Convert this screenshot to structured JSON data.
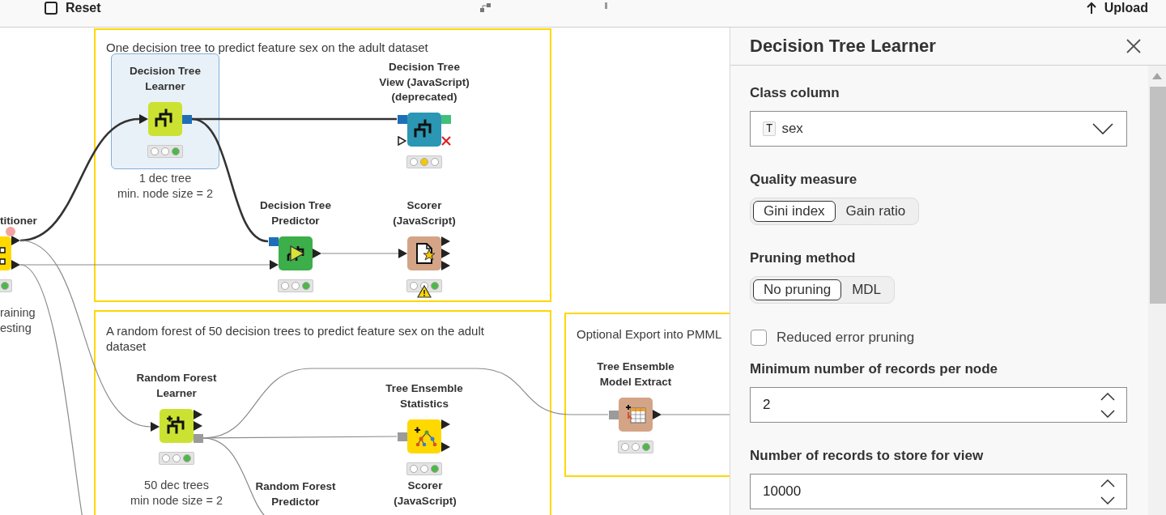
{
  "toolbar": {
    "items": [
      {
        "label": "Reset"
      },
      {
        "label": "Upload"
      }
    ]
  },
  "workflow": {
    "annotations": [
      {
        "text": "One decision tree to predict feature sex on the adult dataset"
      },
      {
        "text": "A random forest of 50 decision trees to predict feature sex on the adult dataset"
      },
      {
        "text": "Optional Export into PMML"
      }
    ],
    "nodes": [
      {
        "title": "titioner",
        "kind": "manipulator",
        "selected": false,
        "lights": [
          {
            "color": "#4db848"
          }
        ],
        "warning": false,
        "comment": [
          "raining",
          "esting"
        ]
      },
      {
        "title": "Decision Tree Learner",
        "kind": "learner",
        "selected": true,
        "lights": [
          {
            "color": "#ffffff"
          },
          {
            "color": "#ffffff"
          },
          {
            "color": "#4db848"
          }
        ],
        "warning": false,
        "comment": [
          "1 dec tree",
          "min. node size = 2"
        ]
      },
      {
        "title": "Decision Tree View (JavaScript) (deprecated)",
        "kind": "visualizer",
        "selected": false,
        "lights": [
          {
            "color": "#ffffff"
          },
          {
            "color": "#f5c800"
          },
          {
            "color": "#ffffff"
          }
        ],
        "warning": false
      },
      {
        "title": "Decision Tree Predictor",
        "kind": "predictor",
        "selected": false,
        "lights": [
          {
            "color": "#ffffff"
          },
          {
            "color": "#ffffff"
          },
          {
            "color": "#4db848"
          }
        ],
        "warning": false
      },
      {
        "title": "Scorer (JavaScript)",
        "kind": "other",
        "selected": false,
        "lights": [
          {
            "color": "#ffffff"
          },
          {
            "color": "#ffffff"
          },
          {
            "color": "#4db848"
          }
        ],
        "warning": true
      },
      {
        "title": "Random Forest Learner",
        "kind": "learner",
        "selected": false,
        "lights": [
          {
            "color": "#ffffff"
          },
          {
            "color": "#ffffff"
          },
          {
            "color": "#4db848"
          }
        ],
        "warning": false,
        "comment": [
          "50 dec trees",
          "min node size = 2"
        ]
      },
      {
        "title": "Tree Ensemble Statistics",
        "kind": "manipulator",
        "selected": false,
        "lights": [
          {
            "color": "#ffffff"
          },
          {
            "color": "#ffffff"
          },
          {
            "color": "#4db848"
          }
        ],
        "warning": false
      },
      {
        "title": "Random Forest Predictor",
        "selected": false
      },
      {
        "title": "Scorer (JavaScript)",
        "selected": false
      },
      {
        "title": "Tree Ensemble Model Extract",
        "kind": "other",
        "selected": false,
        "lights": [
          {
            "color": "#ffffff"
          },
          {
            "color": "#ffffff"
          },
          {
            "color": "#4db848"
          }
        ],
        "warning": false
      }
    ]
  },
  "panel": {
    "title": "Decision Tree Learner",
    "settings": [
      {
        "kind": "dropdown",
        "label": "Class column",
        "type_icon": "T",
        "value": "sex"
      },
      {
        "kind": "segmented",
        "label": "Quality measure",
        "options": [
          {
            "label": "Gini index",
            "selected": true
          },
          {
            "label": "Gain ratio",
            "selected": false
          }
        ]
      },
      {
        "kind": "segmented",
        "label": "Pruning method",
        "options": [
          {
            "label": "No pruning",
            "selected": true
          },
          {
            "label": "MDL",
            "selected": false
          }
        ]
      },
      {
        "kind": "checkbox",
        "label": "Reduced error pruning",
        "checked": false
      },
      {
        "kind": "number",
        "label": "Minimum number of records per node",
        "value": "2"
      },
      {
        "kind": "number",
        "label": "Number of records to store for view",
        "value": "10000"
      }
    ]
  }
}
